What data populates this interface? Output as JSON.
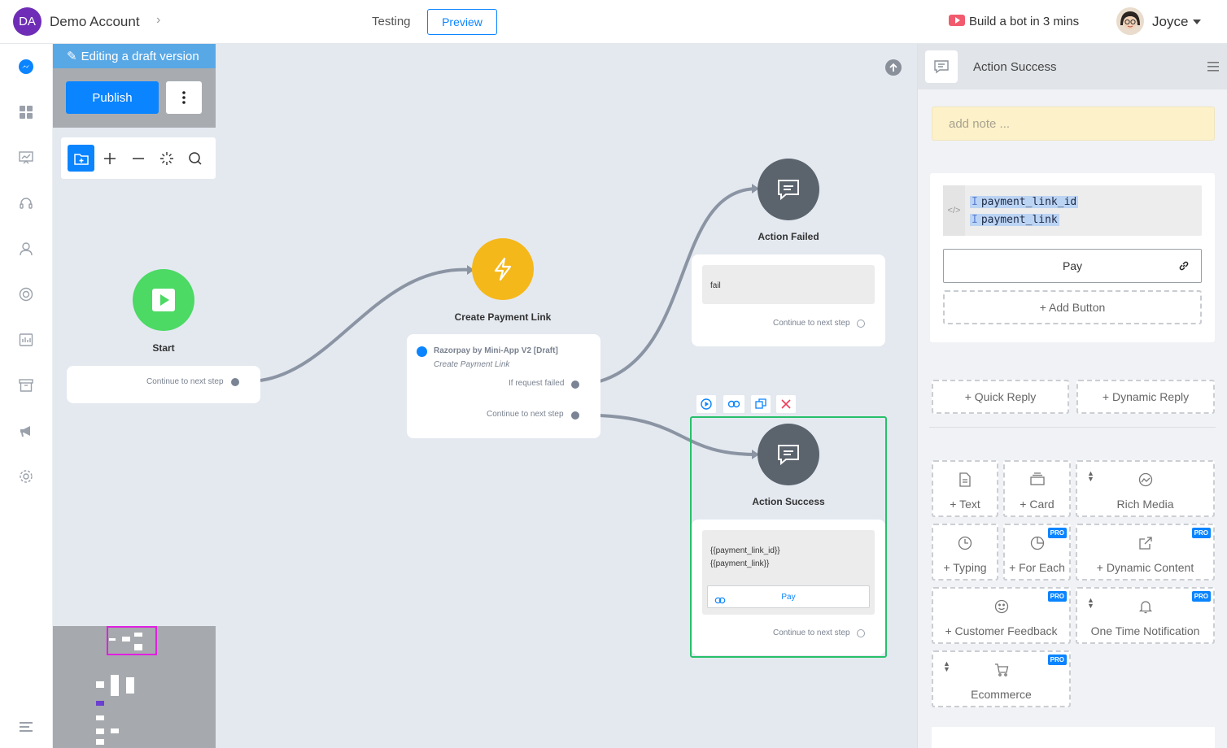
{
  "topbar": {
    "account_initials": "DA",
    "account_name": "Demo Account",
    "testing_label": "Testing",
    "preview_label": "Preview",
    "build_bot_label": "Build a bot in 3 mins",
    "user_name": "Joyce"
  },
  "canvas": {
    "edit_banner": "Editing a draft version",
    "publish_label": "Publish",
    "nodes": {
      "start": {
        "title": "Start",
        "continue": "Continue to next step"
      },
      "create_payment": {
        "title": "Create Payment Link",
        "plugin": "Razorpay by Mini-App V2 [Draft]",
        "action": "Create Payment Link",
        "failed_port": "If request failed",
        "continue": "Continue to next step"
      },
      "action_failed": {
        "title": "Action Failed",
        "text": "fail",
        "continue": "Continue to next step"
      },
      "action_success": {
        "title": "Action Success",
        "text_line1": "{{payment_link_id}}",
        "text_line2": "{{payment_link}}",
        "button": "Pay",
        "continue": "Continue to next step"
      }
    }
  },
  "panel": {
    "title": "Action Success",
    "note_placeholder": "add note ...",
    "variables": [
      "payment_link_id",
      "payment_link"
    ],
    "button_label": "Pay",
    "add_button": "+ Add Button",
    "quick_reply": "+ Quick Reply",
    "dynamic_reply": "+ Dynamic Reply",
    "tiles": {
      "text": "+ Text",
      "card": "+ Card",
      "rich_media": "Rich Media",
      "typing": "+ Typing",
      "for_each": "+ For Each",
      "dynamic_content": "+ Dynamic Content",
      "customer_feedback": "+ Customer Feedback",
      "one_time_notification": "One Time Notification",
      "ecommerce": "Ecommerce"
    },
    "pro_badge": "PRO"
  },
  "colors": {
    "accent": "#0a84ff",
    "start_node": "#4cd964",
    "action_node": "#f5b81b",
    "message_node": "#5b636d",
    "selected_border": "#27c06a"
  }
}
